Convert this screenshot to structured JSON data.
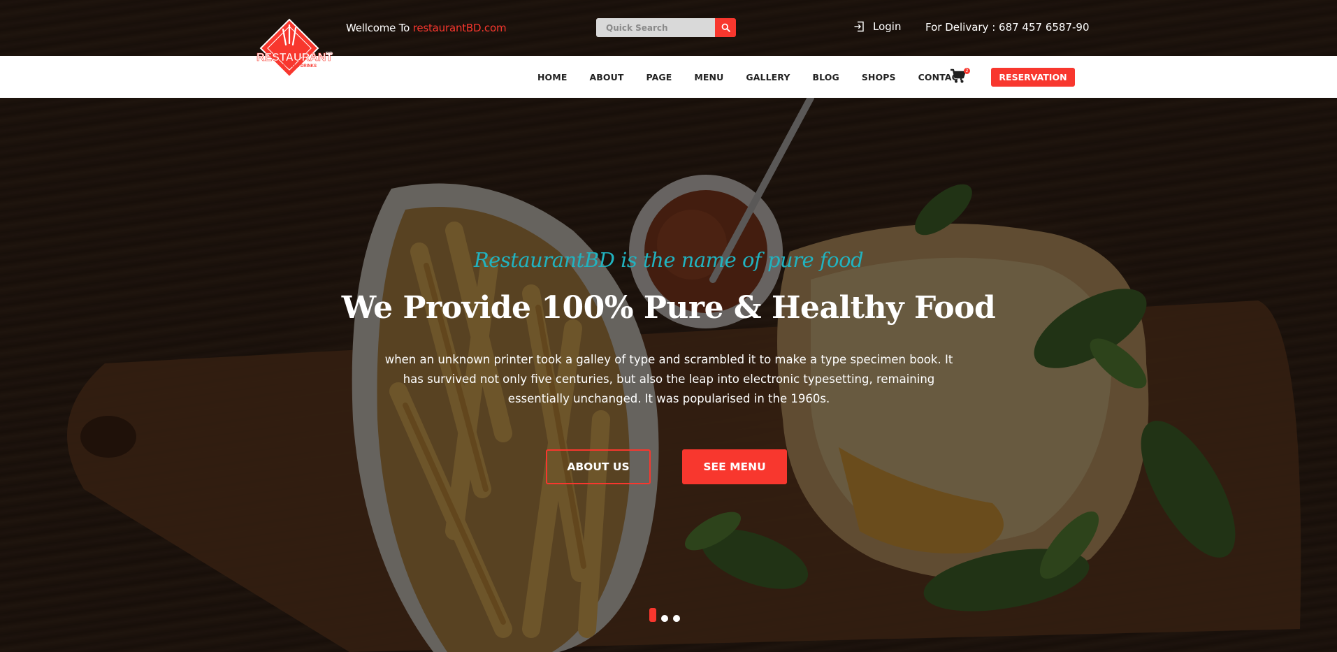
{
  "topbar": {
    "welcome_prefix": "Wellcome To ",
    "welcome_site": "restaurantBD.com",
    "search_placeholder": "Quick Search",
    "login_label": "Login",
    "delivery_text": "For Delivary : 687 457 6587-90"
  },
  "logo": {
    "name": "RESTAURANT",
    "superscript": "BD",
    "tagline": "FOOD & DRINKS"
  },
  "nav": {
    "items": [
      "HOME",
      "ABOUT",
      "PAGE",
      "MENU",
      "GALLERY",
      "BLOG",
      "SHOPS",
      "CONTACT"
    ],
    "cart_count": "2",
    "reservation_label": "RESERVATION"
  },
  "hero": {
    "tagline": "RestaurantBD is the name of pure food",
    "headline": "We Provide 100% Pure & Healthy Food",
    "description": "when an unknown printer took a galley of type and scrambled it to make a type specimen book. It has survived not only five centuries, but also the leap into electronic typesetting, remaining essentially unchanged. It was popularised in the 1960s.",
    "about_button": "ABOUT US",
    "menu_button": "SEE MENU",
    "slides_total": 3,
    "slide_active": 1
  },
  "colors": {
    "accent": "#f8372e",
    "tagline": "#21b3c0",
    "nav_background": "#ffffff",
    "text_light": "#ffffff"
  },
  "icons": {
    "search": "search-icon",
    "login": "login-icon",
    "cart": "cart-icon"
  }
}
